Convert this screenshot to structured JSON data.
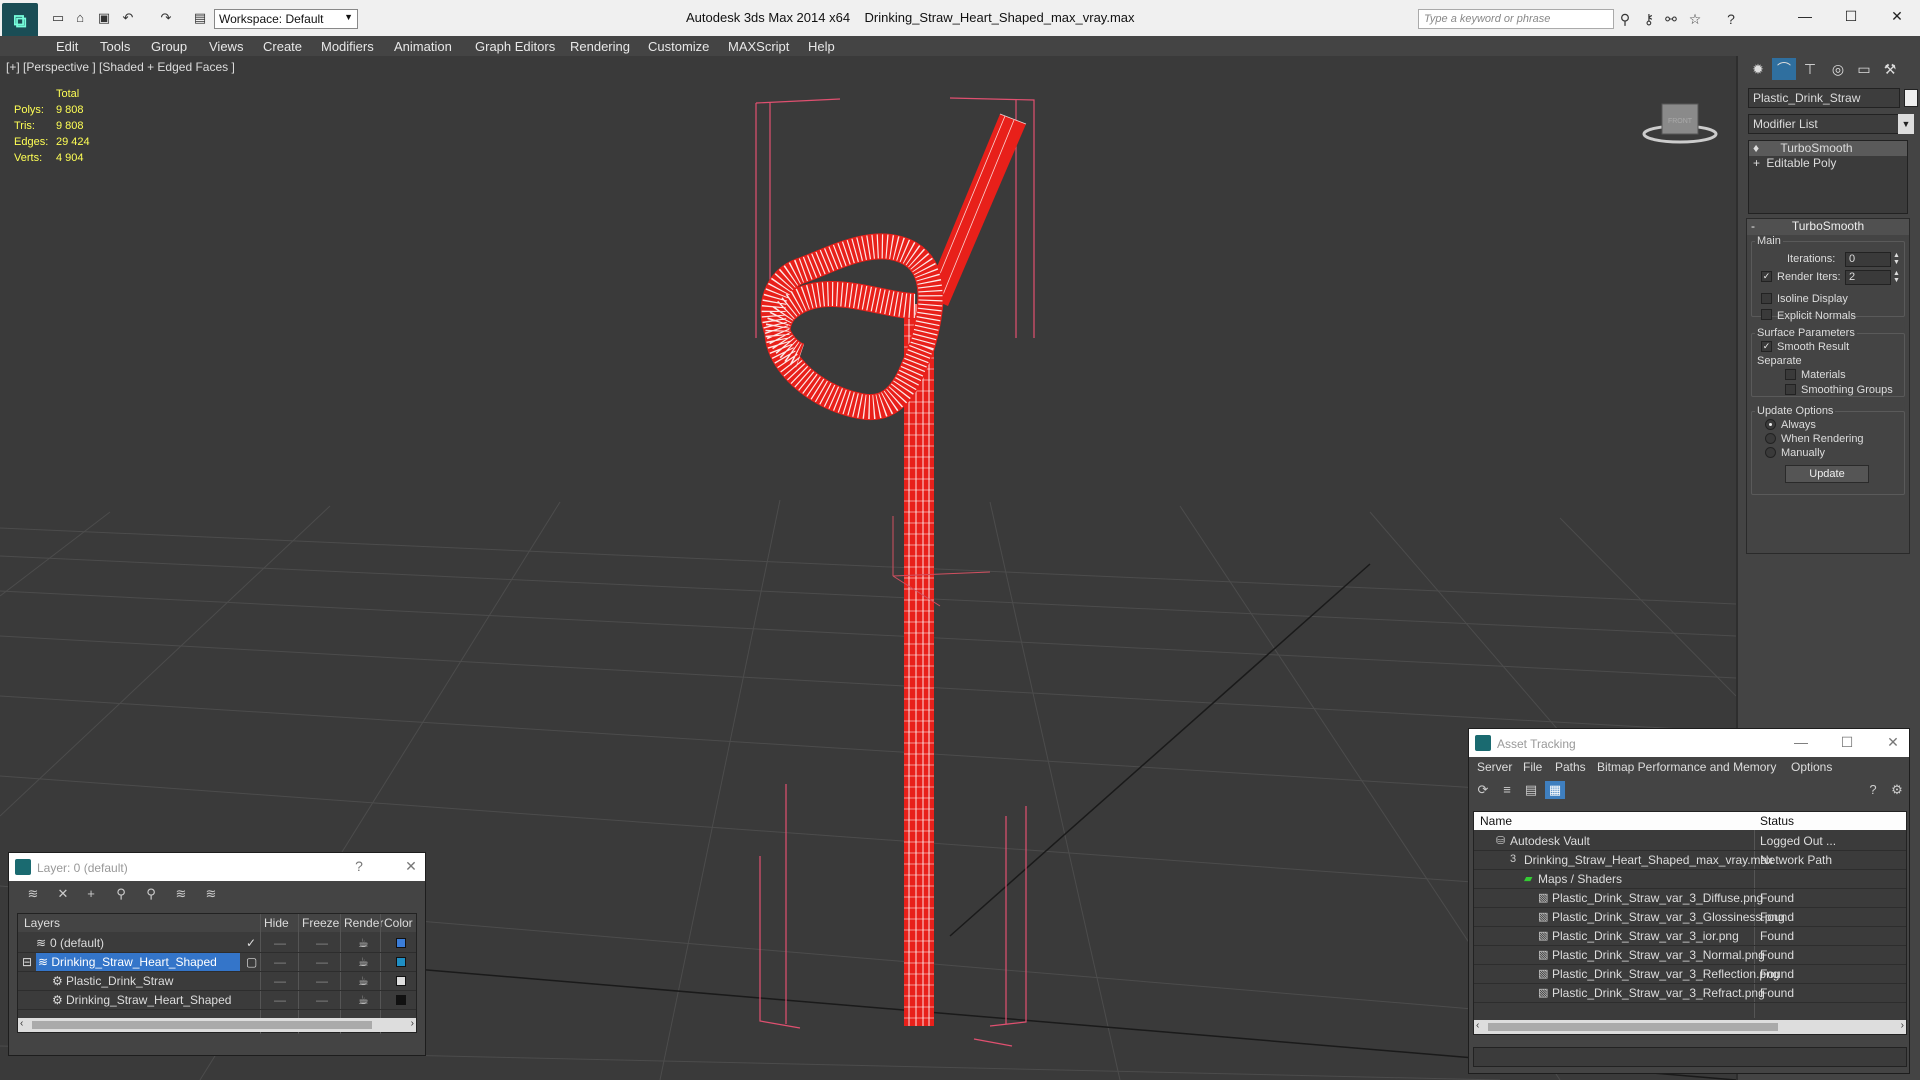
{
  "titlebar": {
    "workspace": "Workspace: Default",
    "app_title": "Autodesk 3ds Max  2014 x64",
    "file_title": "Drinking_Straw_Heart_Shaped_max_vray.max",
    "search_placeholder": "Type a keyword or phrase"
  },
  "menu": [
    "Edit",
    "Tools",
    "Group",
    "Views",
    "Create",
    "Modifiers",
    "Animation",
    "Graph Editors",
    "Rendering",
    "Customize",
    "MAXScript",
    "Help"
  ],
  "viewport": {
    "label": "[+] [Perspective ] [Shaded + Edged Faces ]",
    "stats": {
      "header": "Total",
      "rows": [
        {
          "k": "Polys:",
          "v": "9 808"
        },
        {
          "k": "Tris:",
          "v": "9 808"
        },
        {
          "k": "Edges:",
          "v": "29 424"
        },
        {
          "k": "Verts:",
          "v": "4 904"
        }
      ]
    },
    "viewcube_label": "FRONT",
    "colors": {
      "straw": "#e8201a",
      "bbox": "#e05070",
      "grid": "#4a4a4a",
      "bg": "#3a3a3a"
    }
  },
  "command_panel": {
    "object_name": "Plastic_Drink_Straw",
    "modifier_list": "Modifier List",
    "stack": [
      {
        "label": "TurboSmooth",
        "selected": true
      },
      {
        "label": "Editable Poly",
        "selected": false
      }
    ],
    "turbosmooth": {
      "title": "TurboSmooth",
      "main_label": "Main",
      "iterations_label": "Iterations:",
      "iterations_value": "0",
      "render_iters_label": "Render Iters:",
      "render_iters_value": "2",
      "render_iters_checked": true,
      "isoline_label": "Isoline Display",
      "explicit_normals_label": "Explicit Normals",
      "surface_params_label": "Surface Parameters",
      "smooth_result_label": "Smooth Result",
      "separate_label": "Separate",
      "materials_label": "Materials",
      "smoothing_groups_label": "Smoothing Groups",
      "update_options_label": "Update Options",
      "always_label": "Always",
      "when_rendering_label": "When Rendering",
      "manually_label": "Manually",
      "update_button": "Update"
    }
  },
  "layer_window": {
    "title": "Layer: 0 (default)",
    "help": "?",
    "headers": {
      "layers": "Layers",
      "hide": "Hide",
      "freeze": "Freeze",
      "render": "Render",
      "color": "Color"
    },
    "rows": [
      {
        "name": "0 (default)",
        "indent": 0,
        "color": "#3b7dd8",
        "selected": false
      },
      {
        "name": "Drinking_Straw_Heart_Shaped",
        "indent": 0,
        "color": "#3b7dd8",
        "selected": true
      },
      {
        "name": "Plastic_Drink_Straw",
        "indent": 1,
        "color": "#dddddd",
        "selected": false
      },
      {
        "name": "Drinking_Straw_Heart_Shaped",
        "indent": 1,
        "color": "#111111",
        "selected": false
      }
    ]
  },
  "asset_window": {
    "title": "Asset Tracking",
    "menu": [
      "Server",
      "File",
      "Paths",
      "Bitmap Performance and Memory",
      "Options"
    ],
    "headers": {
      "name": "Name",
      "status": "Status"
    },
    "rows": [
      {
        "name": "Autodesk Vault",
        "status": "Logged Out ...",
        "indent": 1
      },
      {
        "name": "Drinking_Straw_Heart_Shaped_max_vray.max",
        "status": "Network Path",
        "indent": 2
      },
      {
        "name": "Maps / Shaders",
        "status": "",
        "indent": 3
      },
      {
        "name": "Plastic_Drink_Straw_var_3_Diffuse.png",
        "status": "Found",
        "indent": 4
      },
      {
        "name": "Plastic_Drink_Straw_var_3_Glossiness.png",
        "status": "Found",
        "indent": 4
      },
      {
        "name": "Plastic_Drink_Straw_var_3_ior.png",
        "status": "Found",
        "indent": 4
      },
      {
        "name": "Plastic_Drink_Straw_var_3_Normal.png",
        "status": "Found",
        "indent": 4
      },
      {
        "name": "Plastic_Drink_Straw_var_3_Reflection.png",
        "status": "Found",
        "indent": 4
      },
      {
        "name": "Plastic_Drink_Straw_var_3_Refract.png",
        "status": "Found",
        "indent": 4
      }
    ]
  }
}
